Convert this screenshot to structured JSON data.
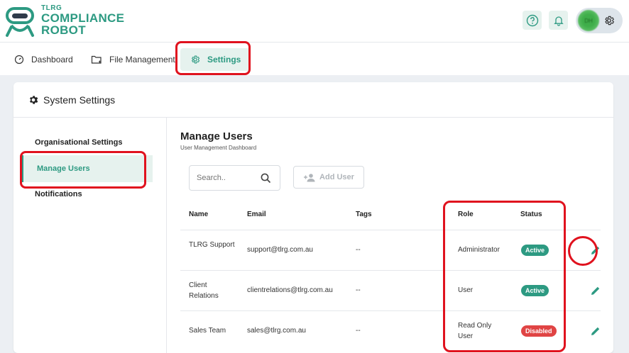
{
  "brand": {
    "small": "TLRG",
    "line1": "COMPLIANCE",
    "line2": "ROBOT"
  },
  "header": {
    "avatar_initials": "DH"
  },
  "nav": {
    "tabs": [
      {
        "label": "Dashboard"
      },
      {
        "label": "File Management"
      },
      {
        "label": "Settings"
      }
    ]
  },
  "card": {
    "title": "System Settings"
  },
  "sidebar": {
    "items": [
      {
        "label": "Organisational Settings"
      },
      {
        "label": "Manage Users"
      },
      {
        "label": "Notifications"
      }
    ]
  },
  "manage_users": {
    "title": "Manage Users",
    "subtitle": "User Management Dashboard",
    "search_placeholder": "Search..",
    "add_user_label": "Add User",
    "columns": {
      "name": "Name",
      "email": "Email",
      "tags": "Tags",
      "role": "Role",
      "status": "Status"
    },
    "rows": [
      {
        "name": "TLRG Support",
        "email": "support@tlrg.com.au",
        "tags": "--",
        "role": "Administrator",
        "status": "Active"
      },
      {
        "name": "Client Relations",
        "email": "clientrelations@tlrg.com.au",
        "tags": "--",
        "role": "User",
        "status": "Active"
      },
      {
        "name": "Sales Team",
        "email": "sales@tlrg.com.au",
        "tags": "--",
        "role": "Read Only User",
        "status": "Disabled"
      }
    ]
  },
  "colors": {
    "accent": "#2d9a82",
    "active_badge": "#2d9a82",
    "disabled_badge": "#e04444",
    "highlight": "#e0121e"
  }
}
